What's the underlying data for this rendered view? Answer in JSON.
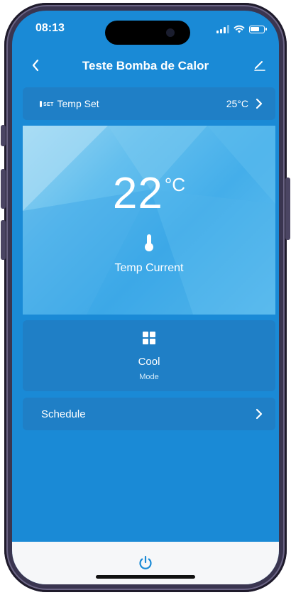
{
  "status_bar": {
    "time": "08:13",
    "icons": [
      "signal-icon",
      "wifi-icon",
      "battery-icon"
    ]
  },
  "nav": {
    "title": "Teste Bomba de Calor",
    "back_icon": "chevron-left-icon",
    "edit_icon": "pencil-icon"
  },
  "temp_set": {
    "badge": "SET",
    "label": "Temp Set",
    "value": "25°C"
  },
  "temp_current": {
    "value": "22",
    "unit": "°C",
    "label": "Temp Current"
  },
  "mode": {
    "value": "Cool",
    "label": "Mode",
    "icon": "grid-icon"
  },
  "schedule": {
    "label": "Schedule"
  },
  "bottom": {
    "power_icon": "power-icon"
  },
  "colors": {
    "background": "#1a8ad6",
    "card": "#1f7fc6",
    "hero_light": "#9ad6f2",
    "hero_dark": "#44aeea",
    "bottom_bar": "#f6f7f9"
  }
}
